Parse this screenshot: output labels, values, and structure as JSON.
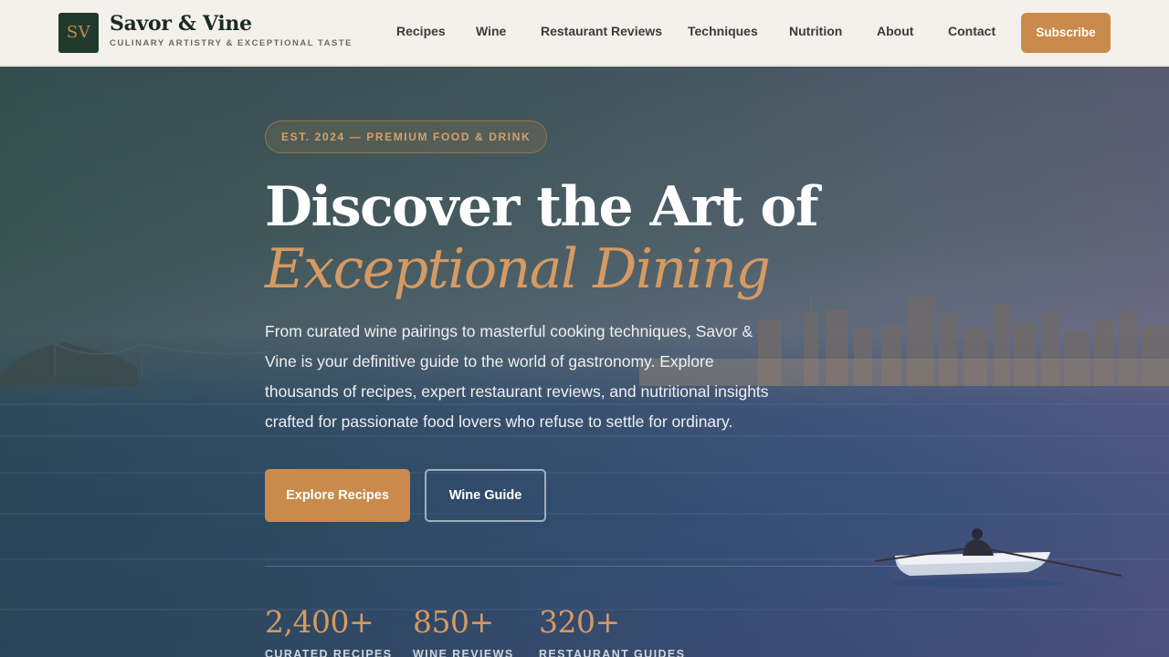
{
  "brand": {
    "mark": "SV",
    "name": "Savor & Vine",
    "tagline": "CULINARY ARTISTRY & EXCEPTIONAL TASTE"
  },
  "nav": {
    "items": [
      {
        "label": "Recipes"
      },
      {
        "label": "Wine"
      },
      {
        "label": "Restaurant Reviews"
      },
      {
        "label": "Techniques"
      },
      {
        "label": "Nutrition"
      },
      {
        "label": "About"
      },
      {
        "label": "Contact"
      }
    ],
    "subscribe_label": "Subscribe"
  },
  "hero": {
    "badge": "EST. 2024 — PREMIUM FOOD & DRINK",
    "title_line1": "Discover the Art of",
    "title_line2": "Exceptional Dining",
    "lead": "From curated wine pairings to masterful cooking techniques, Savor & Vine is your definitive guide to the world of gastronomy. Explore thousands of recipes, expert restaurant reviews, and nutritional insights crafted for passionate food lovers who refuse to settle for ordinary.",
    "primary_cta": "Explore Recipes",
    "secondary_cta": "Wine Guide"
  },
  "stats": [
    {
      "value": "2,400+",
      "label": "CURATED RECIPES"
    },
    {
      "value": "850+",
      "label": "WINE REVIEWS"
    },
    {
      "value": "320+",
      "label": "RESTAURANT GUIDES"
    }
  ],
  "colors": {
    "accent": "#c98a4b",
    "brand_dark": "#1f3a2c",
    "header_bg": "#f4f1ec"
  }
}
